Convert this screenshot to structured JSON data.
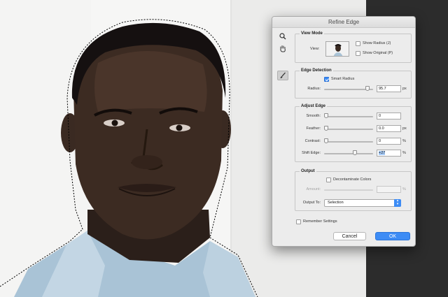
{
  "dialog": {
    "title": "Refine Edge",
    "view_mode": {
      "title": "View Mode",
      "view_label": "View:",
      "show_radius": "Show Radius (J)",
      "show_radius_checked": false,
      "show_original": "Show Original (P)",
      "show_original_checked": false
    },
    "edge_detection": {
      "title": "Edge Detection",
      "smart_radius": "Smart Radius",
      "smart_radius_checked": true,
      "radius_label": "Radius:",
      "radius_value": "95.7",
      "radius_unit": "px",
      "radius_level": 0.92
    },
    "adjust_edge": {
      "title": "Adjust Edge",
      "smooth_label": "Smooth:",
      "smooth_value": "0",
      "smooth_level": 0.0,
      "feather_label": "Feather:",
      "feather_value": "0.0",
      "feather_unit": "px",
      "feather_level": 0.0,
      "contrast_label": "Contrast:",
      "contrast_value": "0",
      "contrast_unit": "%",
      "contrast_level": 0.0,
      "shift_label": "Shift Edge:",
      "shift_value": "+27",
      "shift_unit": "%",
      "shift_level": 0.64
    },
    "output": {
      "title": "Output",
      "decontaminate": "Decontaminate Colors",
      "decontaminate_checked": false,
      "amount_label": "Amount:",
      "amount_unit": "%",
      "output_to_label": "Output To:",
      "output_to_value": "Selection"
    },
    "remember_settings": "Remember Settings",
    "remember_checked": false,
    "cancel_label": "Cancel",
    "ok_label": "OK"
  },
  "colors": {
    "accent": "#3d8cf5",
    "dialog_bg": "#ececec",
    "backdrop": "#2c2c2c"
  },
  "icons": [
    "zoom-icon",
    "hand-icon",
    "refine-radius-brush-icon"
  ]
}
